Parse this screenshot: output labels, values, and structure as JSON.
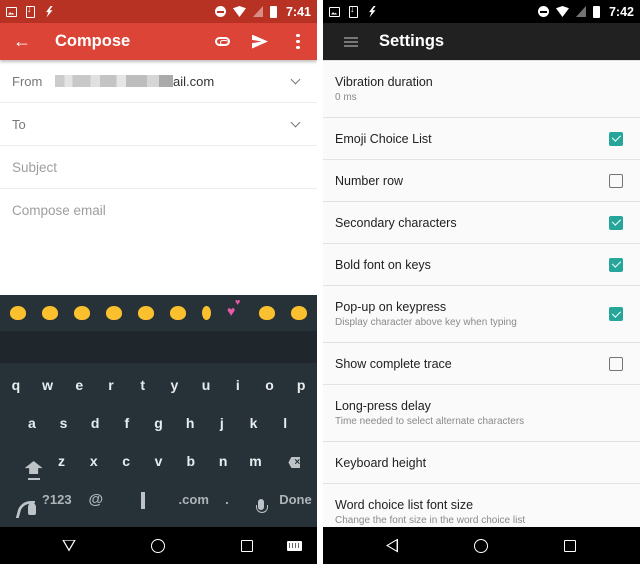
{
  "left_screen": {
    "status_bar": {
      "left_icons": [
        "image-notification-icon",
        "download-notification-icon",
        "charging-bolt-icon"
      ],
      "right_icons": [
        "do-not-disturb-icon",
        "wifi-icon",
        "no-signal-icon",
        "battery-icon"
      ],
      "time": "7:41"
    },
    "app_bar": {
      "title": "Compose",
      "actions": [
        "attach-icon",
        "send-icon",
        "more-options-icon"
      ]
    },
    "fields": {
      "from_label": "From",
      "from_value": "ail.com",
      "to_label": "To",
      "subject_placeholder": "Subject",
      "body_placeholder": "Compose email"
    },
    "keyboard": {
      "emoji_suggestions": [
        "grinning-face",
        "heart-eyes",
        "smiling-face",
        "crying-laughing",
        "expressionless",
        "blushing",
        "ok-hand",
        "two-hearts",
        "smirk",
        "kissing-heart"
      ],
      "rows": [
        [
          "q",
          "w",
          "e",
          "r",
          "t",
          "y",
          "u",
          "i",
          "o",
          "p"
        ],
        [
          "a",
          "s",
          "d",
          "f",
          "g",
          "h",
          "j",
          "k",
          "l"
        ],
        [
          "z",
          "x",
          "c",
          "v",
          "b",
          "n",
          "m"
        ]
      ],
      "bottom_row": {
        "symbols": "?123",
        "at": "@",
        "dotcom": ".com",
        "period": ".",
        "done": "Done"
      }
    }
  },
  "right_screen": {
    "status_bar": {
      "left_icons": [
        "image-notification-icon",
        "download-notification-icon",
        "charging-bolt-icon"
      ],
      "right_icons": [
        "do-not-disturb-icon",
        "wifi-icon",
        "no-signal-icon",
        "battery-icon"
      ],
      "time": "7:42"
    },
    "app_bar": {
      "title": "Settings"
    },
    "settings": [
      {
        "title": "Vibration duration",
        "subtitle": "0 ms",
        "checkbox": null
      },
      {
        "title": "Emoji Choice List",
        "subtitle": "",
        "checkbox": true
      },
      {
        "title": "Number row",
        "subtitle": "",
        "checkbox": false
      },
      {
        "title": "Secondary characters",
        "subtitle": "",
        "checkbox": true
      },
      {
        "title": "Bold font on keys",
        "subtitle": "",
        "checkbox": true
      },
      {
        "title": "Pop-up on keypress",
        "subtitle": "Display character above key when typing",
        "checkbox": true
      },
      {
        "title": "Show complete trace",
        "subtitle": "",
        "checkbox": false
      },
      {
        "title": "Long-press delay",
        "subtitle": "Time needed to select alternate characters",
        "checkbox": null
      },
      {
        "title": "Keyboard height",
        "subtitle": "",
        "checkbox": null
      },
      {
        "title": "Word choice list font size",
        "subtitle": "Change the font size in the word choice list",
        "checkbox": null
      }
    ]
  },
  "colors": {
    "compose_accent": "#db4437",
    "compose_status": "#b83224",
    "settings_appbar": "#212121",
    "keyboard_bg": "#263238",
    "checkbox_on": "#26a69a"
  }
}
